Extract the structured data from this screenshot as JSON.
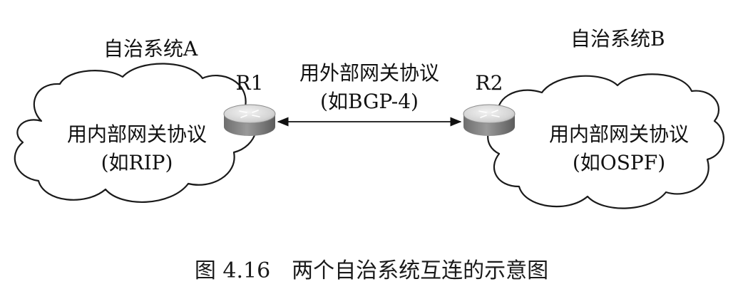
{
  "as_a": {
    "title": "自治系统A",
    "protocol_line1": "用内部网关协议",
    "protocol_line2": "(如RIP)"
  },
  "as_b": {
    "title": "自治系统B",
    "protocol_line1": "用内部网关协议",
    "protocol_line2": "(如OSPF)"
  },
  "router_1": {
    "label": "R1"
  },
  "router_2": {
    "label": "R2"
  },
  "link": {
    "line1": "用外部网关协议",
    "line2": "(如BGP-4)"
  },
  "caption": "图 4.16　两个自治系统互连的示意图"
}
